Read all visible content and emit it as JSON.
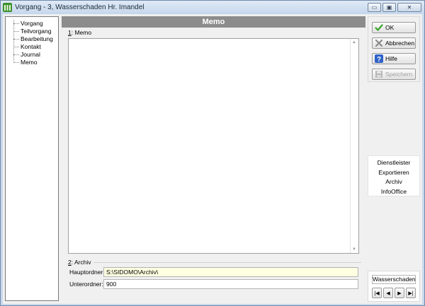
{
  "window": {
    "title": "Vorgang - 3, Wasserschaden Hr. Imandel",
    "controls": {
      "minimize": "▭",
      "maximize": "▣",
      "close": "✕"
    }
  },
  "tree": {
    "items": [
      {
        "label": "Vorgang"
      },
      {
        "label": "Teilvorgang"
      },
      {
        "label": "Bearbeitung"
      },
      {
        "label": "Kontakt"
      },
      {
        "label": "Journal"
      },
      {
        "label": "Memo"
      }
    ]
  },
  "memo": {
    "header": "Memo",
    "group1_number": "1",
    "group1_label": ": Memo",
    "text": "",
    "group2_number": "2",
    "group2_label": ": Archiv",
    "hauptordner_label": "Hauptordner:",
    "hauptordner_value": "S:\\SIDOMO\\Archiv\\",
    "unterordner_label": "Unterordner:",
    "unterordner_value": "900"
  },
  "buttons": {
    "ok": "OK",
    "abbrechen": "Abbrechen",
    "hilfe": "Hilfe",
    "speichern": "Speichern"
  },
  "links": {
    "items": [
      {
        "label": "Dienstleister"
      },
      {
        "label": "Exportieren"
      },
      {
        "label": "Archiv"
      },
      {
        "label": "InfoOffice"
      }
    ]
  },
  "navigator": {
    "title": "Wasserschaden H",
    "first": "|◀",
    "prev": "◀",
    "next": "▶",
    "last": "▶|"
  },
  "colors": {
    "header_bg": "#8c8c8c",
    "folder_field_bg": "#ffffe1",
    "title_bar": "#c6d7ec"
  }
}
